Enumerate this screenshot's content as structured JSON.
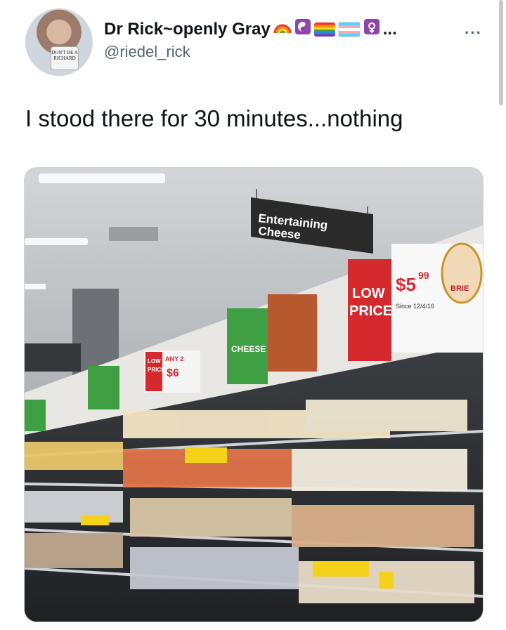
{
  "author": {
    "display_name": "Dr Rick~openly Gray",
    "handle": "@riedel_rick",
    "avatar_mug_text": "DON'T BE A RICHARD",
    "name_ellipsis": "..."
  },
  "menu": {
    "more_label": "···"
  },
  "tweet": {
    "text": "I stood there for 30 minutes...nothing"
  },
  "photo": {
    "hanging_sign": "Entertaining\nCheese",
    "low_price_badge": "LOW\nPRICE",
    "price": "$5",
    "price_cents": "99",
    "since_text": "Since 12/4/16",
    "brie_label": "BRIE",
    "cheese_sign": "CHEESE",
    "any2_label": "ANY 2",
    "any2_price": "$6",
    "colors": {
      "accent_red": "#d42a2e",
      "accent_green": "#3ea043",
      "sign_dark": "#2a2a2a"
    }
  },
  "colors": {
    "text": "#0f1419",
    "secondary": "#536471"
  }
}
